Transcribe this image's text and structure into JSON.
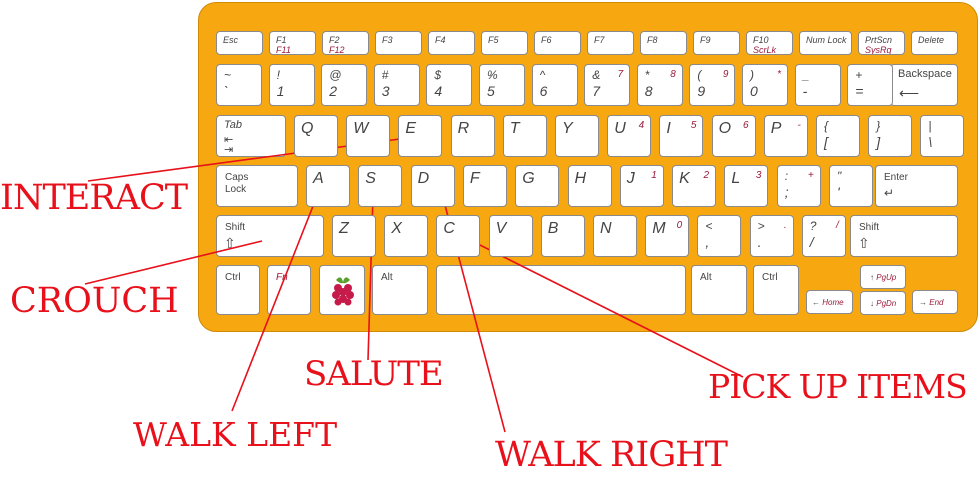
{
  "colors": {
    "board": "#f7a70f",
    "label": "#e8101a",
    "fn_text": "#9b1b3a"
  },
  "keys": {
    "row0": {
      "esc": "Esc",
      "f1": "F1",
      "f1b": "F11",
      "f2": "F2",
      "f2b": "F12",
      "f3": "F3",
      "f4": "F4",
      "f5": "F5",
      "f6": "F6",
      "f7": "F7",
      "f8": "F8",
      "f9": "F9",
      "f10": "F10",
      "f10b": "ScrLk",
      "numlock": "Num Lock",
      "prtscn": "PrtScn",
      "prtscnb": "SysRq",
      "delete": "Delete"
    },
    "row1": [
      {
        "s": "~",
        "b": "`"
      },
      {
        "s": "!",
        "b": "1"
      },
      {
        "s": "@",
        "b": "2"
      },
      {
        "s": "#",
        "b": "3"
      },
      {
        "s": "$",
        "b": "4"
      },
      {
        "s": "%",
        "b": "5"
      },
      {
        "s": "^",
        "b": "6"
      },
      {
        "s": "&",
        "b": "7",
        "n": "7"
      },
      {
        "s": "*",
        "b": "8",
        "n": "8"
      },
      {
        "s": "(",
        "b": "9",
        "n": "9"
      },
      {
        "s": ")",
        "b": "0",
        "n": "*"
      },
      {
        "s": "_",
        "b": "-"
      },
      {
        "s": "+",
        "b": "="
      }
    ],
    "backspace": "Backspace",
    "tab": "Tab",
    "row2": [
      {
        "k": "Q"
      },
      {
        "k": "W"
      },
      {
        "k": "E"
      },
      {
        "k": "R"
      },
      {
        "k": "T"
      },
      {
        "k": "Y"
      },
      {
        "k": "U",
        "n": "4"
      },
      {
        "k": "I",
        "n": "5"
      },
      {
        "k": "O",
        "n": "6"
      },
      {
        "k": "P",
        "n": "-"
      },
      {
        "s": "{",
        "b": "["
      },
      {
        "s": "}",
        "b": "]"
      },
      {
        "s": "|",
        "b": "\\"
      }
    ],
    "caps1": "Caps",
    "caps2": "Lock",
    "row3": [
      {
        "k": "A"
      },
      {
        "k": "S"
      },
      {
        "k": "D"
      },
      {
        "k": "F"
      },
      {
        "k": "G"
      },
      {
        "k": "H"
      },
      {
        "k": "J",
        "n": "1"
      },
      {
        "k": "K",
        "n": "2"
      },
      {
        "k": "L",
        "n": "3"
      },
      {
        "s": ":",
        "b": ";",
        "n": "+"
      },
      {
        "s": "\"",
        "b": "'"
      }
    ],
    "enter": "Enter",
    "shift_l": "Shift",
    "row4": [
      {
        "k": "Z"
      },
      {
        "k": "X"
      },
      {
        "k": "C"
      },
      {
        "k": "V"
      },
      {
        "k": "B"
      },
      {
        "k": "N"
      },
      {
        "k": "M",
        "n": "0"
      },
      {
        "s": "<",
        "b": ",",
        "n": ""
      },
      {
        "s": ">",
        "b": ".",
        "n": "."
      },
      {
        "s": "?",
        "b": "/",
        "n": "/"
      }
    ],
    "shift_r": "Shift",
    "ctrl_l": "Ctrl",
    "fn": "Fn",
    "alt_l": "Alt",
    "alt_r": "Alt",
    "ctrl_r": "Ctrl",
    "pgup": "PgUp",
    "pgdn": "PgDn",
    "home": "Home",
    "end": "End"
  },
  "labels": {
    "interact": "INTERACT",
    "crouch": "CROUCH",
    "salute": "SALUTE",
    "walk_left": "WALK LEFT",
    "walk_right": "WALK RIGHT",
    "pick_up": "PICK UP ITEMS"
  }
}
